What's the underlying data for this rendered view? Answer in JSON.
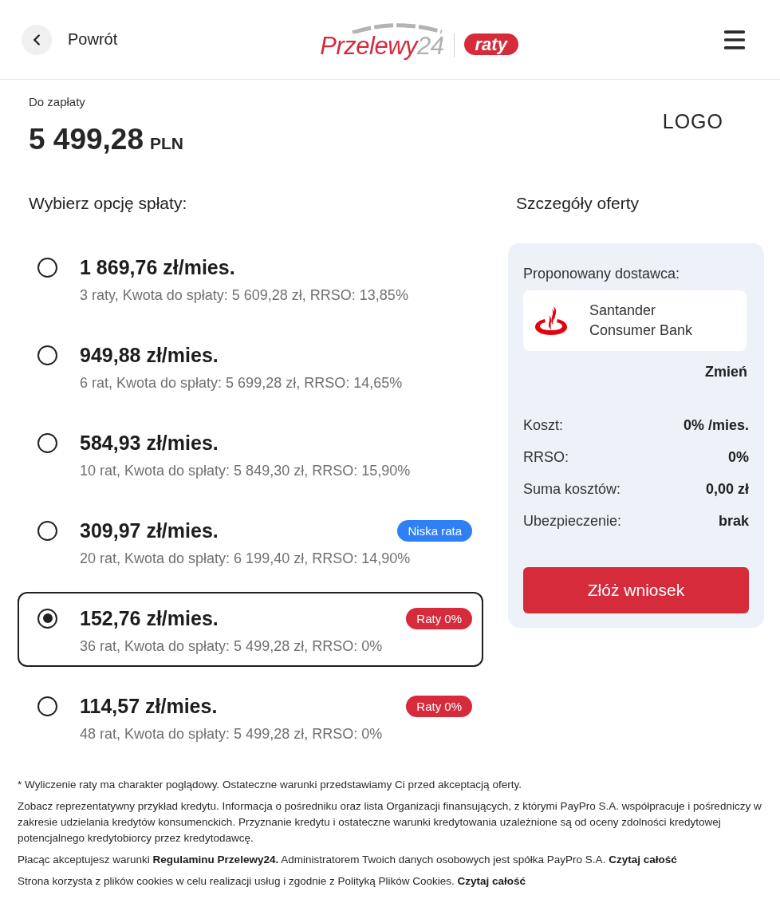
{
  "header": {
    "back_label": "Powrót",
    "logo": {
      "wordmark": [
        "Przelewy",
        "24"
      ],
      "badge": "raty"
    }
  },
  "payment": {
    "label": "Do zapłaty",
    "amount": "5 499,28",
    "currency": "PLN",
    "merchant_logo": "LOGO"
  },
  "options_section": {
    "title": "Wybierz opcję spłaty:",
    "options": [
      {
        "amount": "1 869,76 zł/mies.",
        "details": "3 raty, Kwota do spłaty: 5 609,28 zł, RRSO: 13,85%",
        "selected": false
      },
      {
        "amount": "949,88 zł/mies.",
        "details": "6 rat, Kwota do spłaty: 5 699,28 zł, RRSO: 14,65%",
        "selected": false
      },
      {
        "amount": "584,93 zł/mies.",
        "details": "10 rat, Kwota do spłaty: 5 849,30 zł, RRSO: 15,90%",
        "selected": false
      },
      {
        "amount": "309,97 zł/mies.",
        "details": "20 rat, Kwota do spłaty: 6 199,40 zł, RRSO: 14,90%",
        "selected": false,
        "badge": {
          "text": "Niska rata",
          "color": "#2f80f7"
        }
      },
      {
        "amount": "152,76 zł/mies.",
        "details": "36 rat, Kwota do spłaty: 5 499,28 zł, RRSO: 0%",
        "selected": true,
        "badge": {
          "text": "Raty 0%",
          "color": "#d52b3b"
        }
      },
      {
        "amount": "114,57 zł/mies.",
        "details": "48 rat, Kwota do spłaty: 5 499,28 zł, RRSO: 0%",
        "selected": false,
        "badge": {
          "text": "Raty 0%",
          "color": "#d52b3b"
        }
      }
    ]
  },
  "offer": {
    "title": "Szczegóły oferty",
    "provider_label": "Proponowany dostawca:",
    "provider_name": "Santander Consumer Bank",
    "change_link": "Zmień",
    "rows": [
      {
        "label": "Koszt:",
        "value": "0% /mies."
      },
      {
        "label": "RRSO:",
        "value": "0%"
      },
      {
        "label": "Suma kosztów:",
        "value": "0,00 zł"
      },
      {
        "label": "Ubezpieczenie:",
        "value": "brak"
      }
    ],
    "submit": "Złóż wniosek"
  },
  "footer": {
    "notes": [
      {
        "segments": [
          {
            "kind": "text",
            "text": "* Wyliczenie raty ma charakter poglądowy. Ostateczne warunki przedstawiamy Ci przed akceptacją oferty."
          }
        ]
      },
      {
        "segments": [
          {
            "kind": "text",
            "text": "Zobacz reprezentatywny przykład kredytu. Informacja o pośredniku oraz lista Organizacji finansujących, z którymi PayPro S.A. współpracuje i pośredniczy w zakresie udzielania kredytów konsumenckich. Przyznanie kredytu i ostateczne warunki kredytowania uzależnione są od oceny zdolności kredytowej potencjalnego kredytobiorcy przez kredytodawcę."
          }
        ]
      },
      {
        "segments": [
          {
            "kind": "text",
            "text": "Płacąc akceptujesz warunki"
          },
          {
            "kind": "link",
            "text": "Regulaminu Przelewy24."
          },
          {
            "kind": "text",
            "text": "Administratorem Twoich danych osobowych jest spółka PayPro S.A."
          },
          {
            "kind": "link",
            "text": "Czytaj całość"
          }
        ]
      },
      {
        "segments": [
          {
            "kind": "text",
            "text": "Strona korzysta z plików cookies w celu realizacji usług i zgodnie z Polityką Plików Cookies."
          },
          {
            "kind": "link",
            "text": "Czytaj całość"
          }
        ]
      }
    ]
  }
}
